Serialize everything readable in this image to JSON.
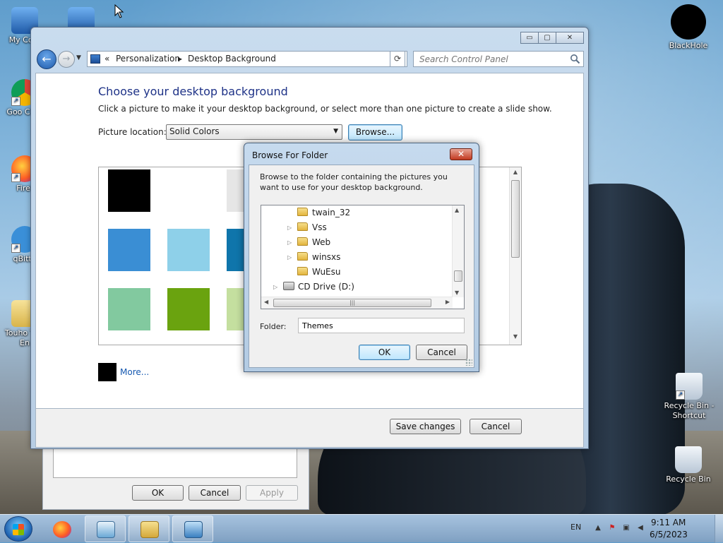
{
  "desktop": {
    "icons": [
      {
        "label": "My Com"
      },
      {
        "label": ""
      },
      {
        "label": "Goo Chro"
      },
      {
        "label": "Firef"
      },
      {
        "label": "qBitto"
      },
      {
        "label": "Touho The En"
      },
      {
        "label": "BlackHole"
      },
      {
        "label": "Recycle Bin - Shortcut"
      },
      {
        "label": "Recycle Bin"
      }
    ]
  },
  "background_dialog": {
    "ok_label": "OK",
    "cancel_label": "Cancel",
    "apply_label": "Apply"
  },
  "window": {
    "caption": {
      "minimize": "▭",
      "maximize": "▢",
      "close": "✕"
    },
    "nav": {
      "back": "←",
      "forward": "→",
      "chevron": "«"
    },
    "breadcrumb": [
      "Personalization",
      "Desktop Background"
    ],
    "search_placeholder": "Search Control Panel",
    "page_title": "Choose your desktop background",
    "page_desc": "Click a picture to make it your desktop background, or select more than one picture to create a slide show.",
    "picture_location_label": "Picture location:",
    "picture_location_value": "Solid Colors",
    "browse_label": "Browse...",
    "swatches": [
      {
        "color": "#000000"
      },
      {
        "color": "#ffffff"
      },
      {
        "color": "#e6e6e6"
      },
      {
        "color": "#3a8ed4"
      },
      {
        "color": "#8ed0e9"
      },
      {
        "color": "#0f75ab"
      },
      {
        "color": "#82c99f"
      },
      {
        "color": "#6aa30f"
      },
      {
        "color": "#c4df9f"
      }
    ],
    "more_label": "More...",
    "more_color": "#000000",
    "save_label": "Save changes",
    "cancel_label": "Cancel"
  },
  "browse_dialog": {
    "title": "Browse For Folder",
    "close": "✕",
    "description": "Browse to the folder containing the pictures you want to use for your desktop background.",
    "tree": [
      {
        "label": "twain_32",
        "expandable": false
      },
      {
        "label": "Vss",
        "expandable": true
      },
      {
        "label": "Web",
        "expandable": true
      },
      {
        "label": "winsxs",
        "expandable": true
      },
      {
        "label": "WuEsu",
        "expandable": false
      },
      {
        "label": "CD Drive (D:)",
        "expandable": true
      }
    ],
    "folder_label": "Folder:",
    "folder_value": "Themes",
    "ok_label": "OK",
    "cancel_label": "Cancel"
  },
  "taskbar": {
    "apps": [
      "firefox-icon",
      "control-panel-icon",
      "explorer-icon",
      "display-icon"
    ],
    "language": "EN",
    "time": "9:11 AM",
    "date": "6/5/2023"
  }
}
